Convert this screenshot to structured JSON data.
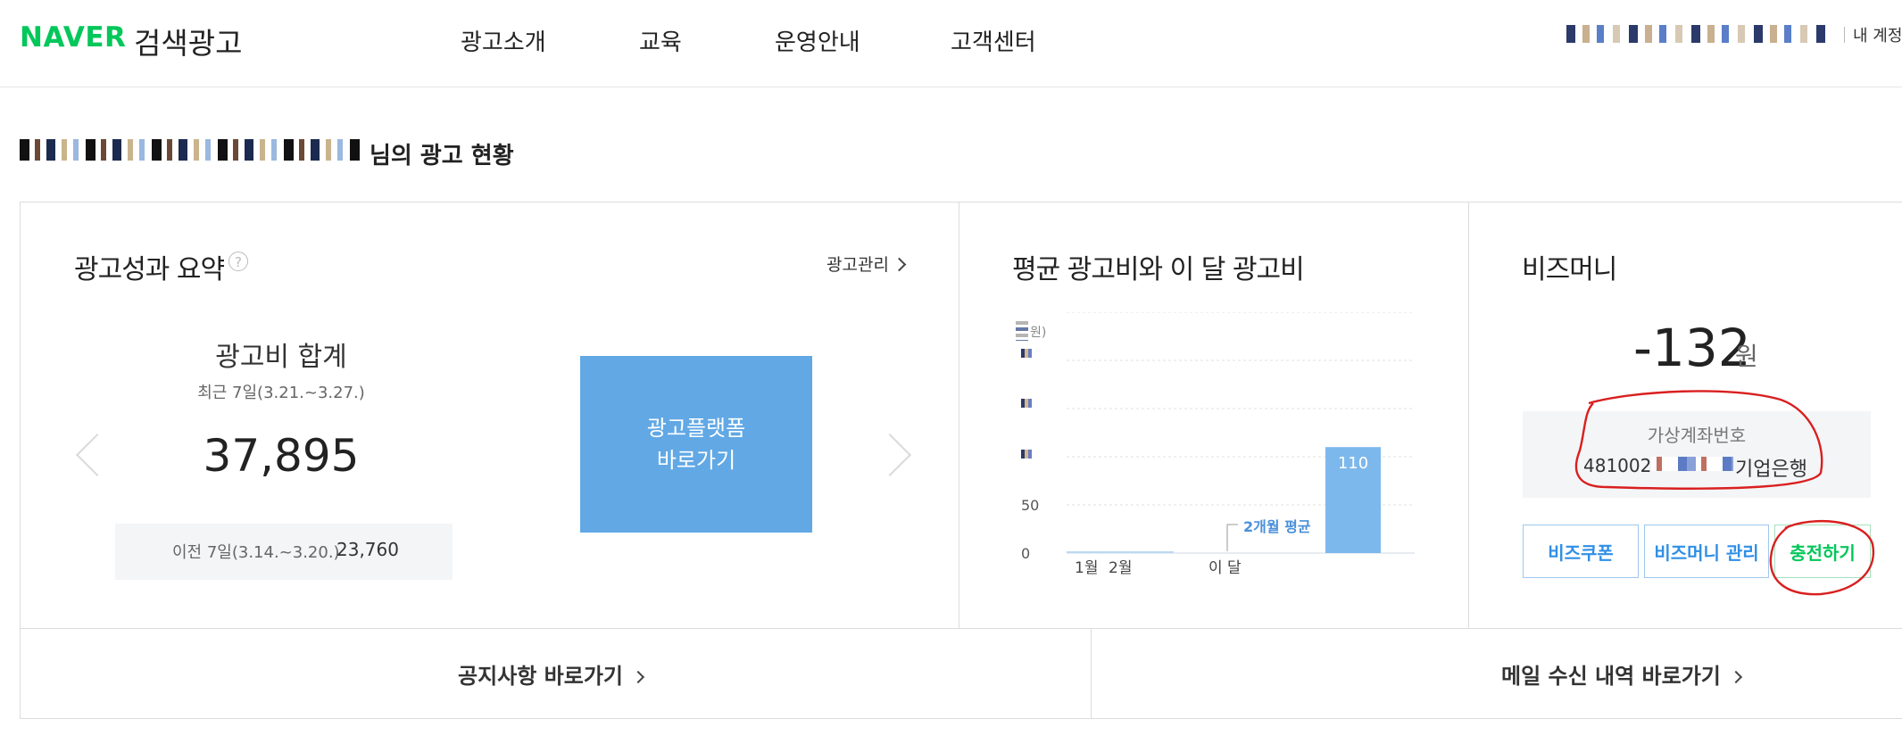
{
  "header": {
    "logo_brand": "NAVER",
    "logo_service": "검색광고",
    "nav": [
      "광고소개",
      "교육",
      "운영안내",
      "고객센터"
    ],
    "my_account": "내 계정"
  },
  "greeting": "님의 광고 현황",
  "summary": {
    "title": "광고성과 요약",
    "help": "?",
    "manage_link": "광고관리",
    "spend_label": "광고비 합계",
    "period": "최근 7일(3.21.~3.27.)",
    "spend_value": "37,895",
    "prev_label": "이전 7일(3.14.~3.20.)",
    "prev_value": "23,760",
    "platform_button_line1": "광고플랫폼",
    "platform_button_line2": "바로가기"
  },
  "chart": {
    "title": "평균 광고비와 이 달 광고비",
    "unit_suffix": "원)",
    "bar_label": "110",
    "avg_annotation": "2개월 평균",
    "colors": {
      "bar": "#7db8ec",
      "annotation": "#4a90d9"
    }
  },
  "chart_data": {
    "type": "bar",
    "categories": [
      "1월",
      "2월",
      "이 달"
    ],
    "values": [
      0,
      0,
      110
    ],
    "yticks": [
      0,
      50
    ],
    "ylim": [
      0,
      250
    ],
    "grid": true,
    "annotation": "2개월 평균"
  },
  "bizmoney": {
    "title": "비즈머니",
    "value": "-132",
    "unit": "원",
    "account_label": "가상계좌번호",
    "account_prefix": "481002",
    "bank": "기업은행",
    "buttons": [
      "비즈쿠폰",
      "비즈머니 관리",
      "충전하기"
    ]
  },
  "footer": {
    "notice_link": "공지사항 바로가기",
    "mail_link": "메일 수신 내역 바로가기"
  },
  "colors": {
    "brand_green": "#03c75a",
    "platform_blue": "#61a8e5",
    "button_blue": "#2f8fe6",
    "annotation_red": "#d91f1f"
  }
}
